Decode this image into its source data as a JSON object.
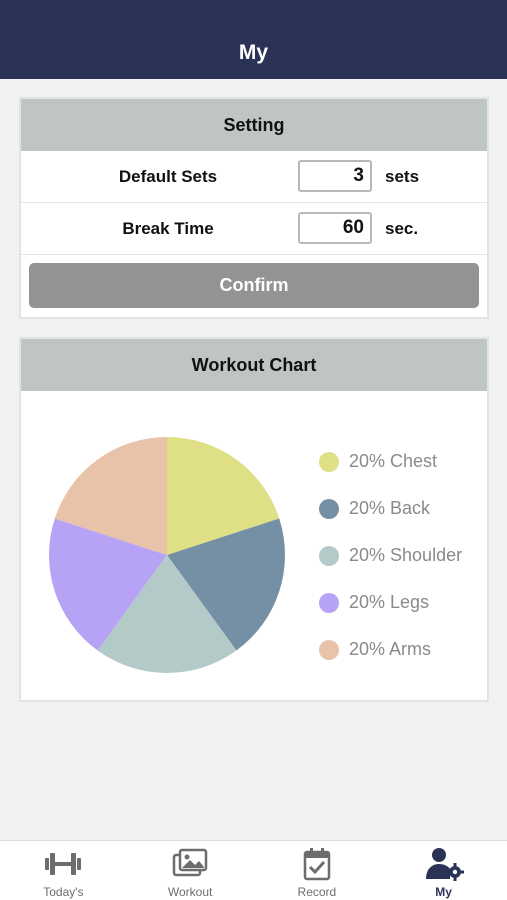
{
  "header": {
    "title": "My"
  },
  "setting": {
    "title": "Setting",
    "rows": [
      {
        "label": "Default Sets",
        "value": "3",
        "unit": "sets"
      },
      {
        "label": "Break Time",
        "value": "60",
        "unit": "sec."
      }
    ],
    "confirm_label": "Confirm"
  },
  "workout_chart": {
    "title": "Workout Chart"
  },
  "chart_data": {
    "type": "pie",
    "title": "Workout Chart",
    "categories": [
      "Chest",
      "Back",
      "Shoulder",
      "Legs",
      "Arms"
    ],
    "values": [
      20,
      20,
      20,
      20,
      20
    ],
    "labels": [
      "20% Chest",
      "20% Back",
      "20% Shoulder",
      "20% Legs",
      "20% Arms"
    ],
    "colors": [
      "#dfdf85",
      "#7590a5",
      "#b4cac8",
      "#b6a3f6",
      "#e8c2a9"
    ],
    "legend": "right"
  },
  "tabs": [
    {
      "label": "Today's",
      "icon": "dumbbell-icon",
      "active": false
    },
    {
      "label": "Workout",
      "icon": "gallery-icon",
      "active": false
    },
    {
      "label": "Record",
      "icon": "calendar-check-icon",
      "active": false
    },
    {
      "label": "My",
      "icon": "user-gear-icon",
      "active": true
    }
  ],
  "colors": {
    "header": "#2a3356",
    "card_head": "#bfc5c3",
    "confirm": "#939393"
  }
}
